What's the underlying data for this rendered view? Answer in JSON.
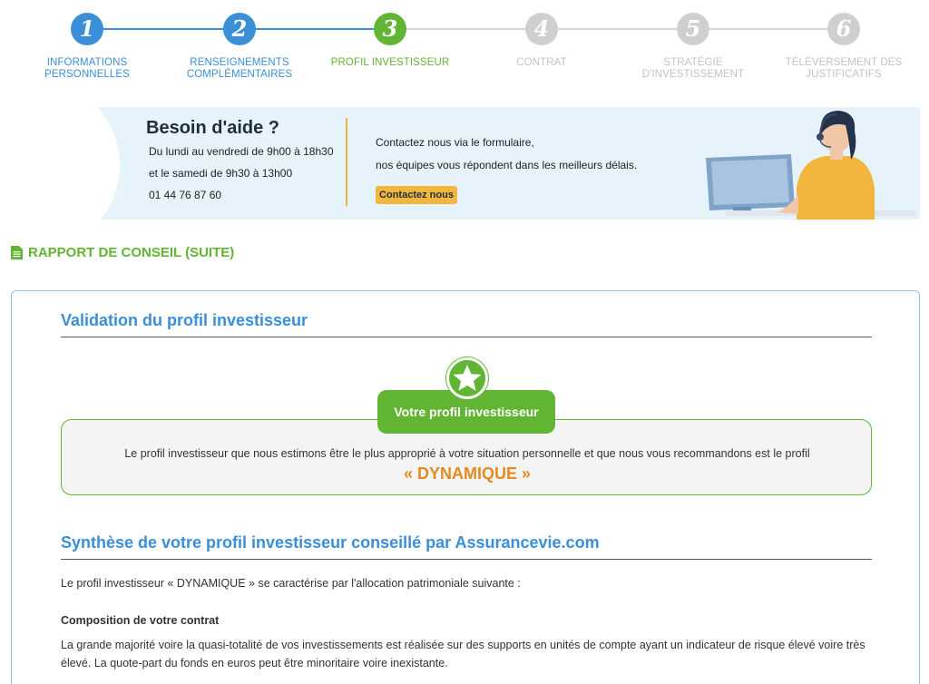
{
  "stepper": {
    "steps": [
      {
        "number": "1",
        "label_line1": "INFORMATIONS",
        "label_line2": "PERSONNELLES",
        "state": "done"
      },
      {
        "number": "2",
        "label_line1": "RENSEIGNEMENTS",
        "label_line2": "COMPLÉMENTAIRES",
        "state": "done"
      },
      {
        "number": "3",
        "label_line1": "PROFIL INVESTISSEUR",
        "label_line2": "",
        "state": "active"
      },
      {
        "number": "4",
        "label_line1": "CONTRAT",
        "label_line2": "",
        "state": "todo"
      },
      {
        "number": "5",
        "label_line1": "STRATÉGIE",
        "label_line2": "D'INVESTISSEMENT",
        "state": "todo"
      },
      {
        "number": "6",
        "label_line1": "TÉLÉVERSEMENT DES",
        "label_line2": "JUSTIFICATIFS",
        "state": "todo"
      }
    ],
    "colors": {
      "done": "#3a8fd8",
      "active": "#61b532",
      "todo": "#cfcfcf"
    }
  },
  "help": {
    "title": "Besoin d'aide ?",
    "hours_weekdays": "Du lundi au vendredi de 9h00 à 18h30",
    "hours_saturday": "et le samedi de 9h30 à 13h00",
    "phone": "01 44 76 87 60",
    "contact_line1": "Contactez nous via le formulaire,",
    "contact_line2": "nos équipes vous répondent dans les meilleurs délais.",
    "contact_button": "Contactez nous"
  },
  "section": {
    "icon": "document-icon",
    "title": "RAPPORT DE CONSEIL (SUITE)"
  },
  "validation": {
    "heading": "Validation du profil investisseur",
    "badge_icon": "star-icon",
    "tab_label": "Votre profil investisseur",
    "description": "Le profil investisseur que nous estimons être le plus approprié à votre situation personnelle et que nous vous recommandons est le profil",
    "profile": "« DYNAMIQUE »"
  },
  "synthese": {
    "heading": "Synthèse de votre profil investisseur conseillé par Assurancevie.com",
    "intro": "Le profil investisseur « DYNAMIQUE » se caractérise par l'allocation patrimoniale suivante :",
    "composition_title": "Composition de votre contrat",
    "composition_text": "La grande majorité voire la quasi-totalité de vos investissements est réalisée sur des supports en unités de compte ayant un indicateur de risque élevé voire très élevé. La quote-part du fonds en euros peut être minoritaire voire inexistante."
  },
  "colors": {
    "blue": "#3a8fd8",
    "green": "#61b532",
    "orange": "#e68a1f",
    "yellow": "#f2b63c",
    "banner_bg": "#e7f3fb"
  }
}
